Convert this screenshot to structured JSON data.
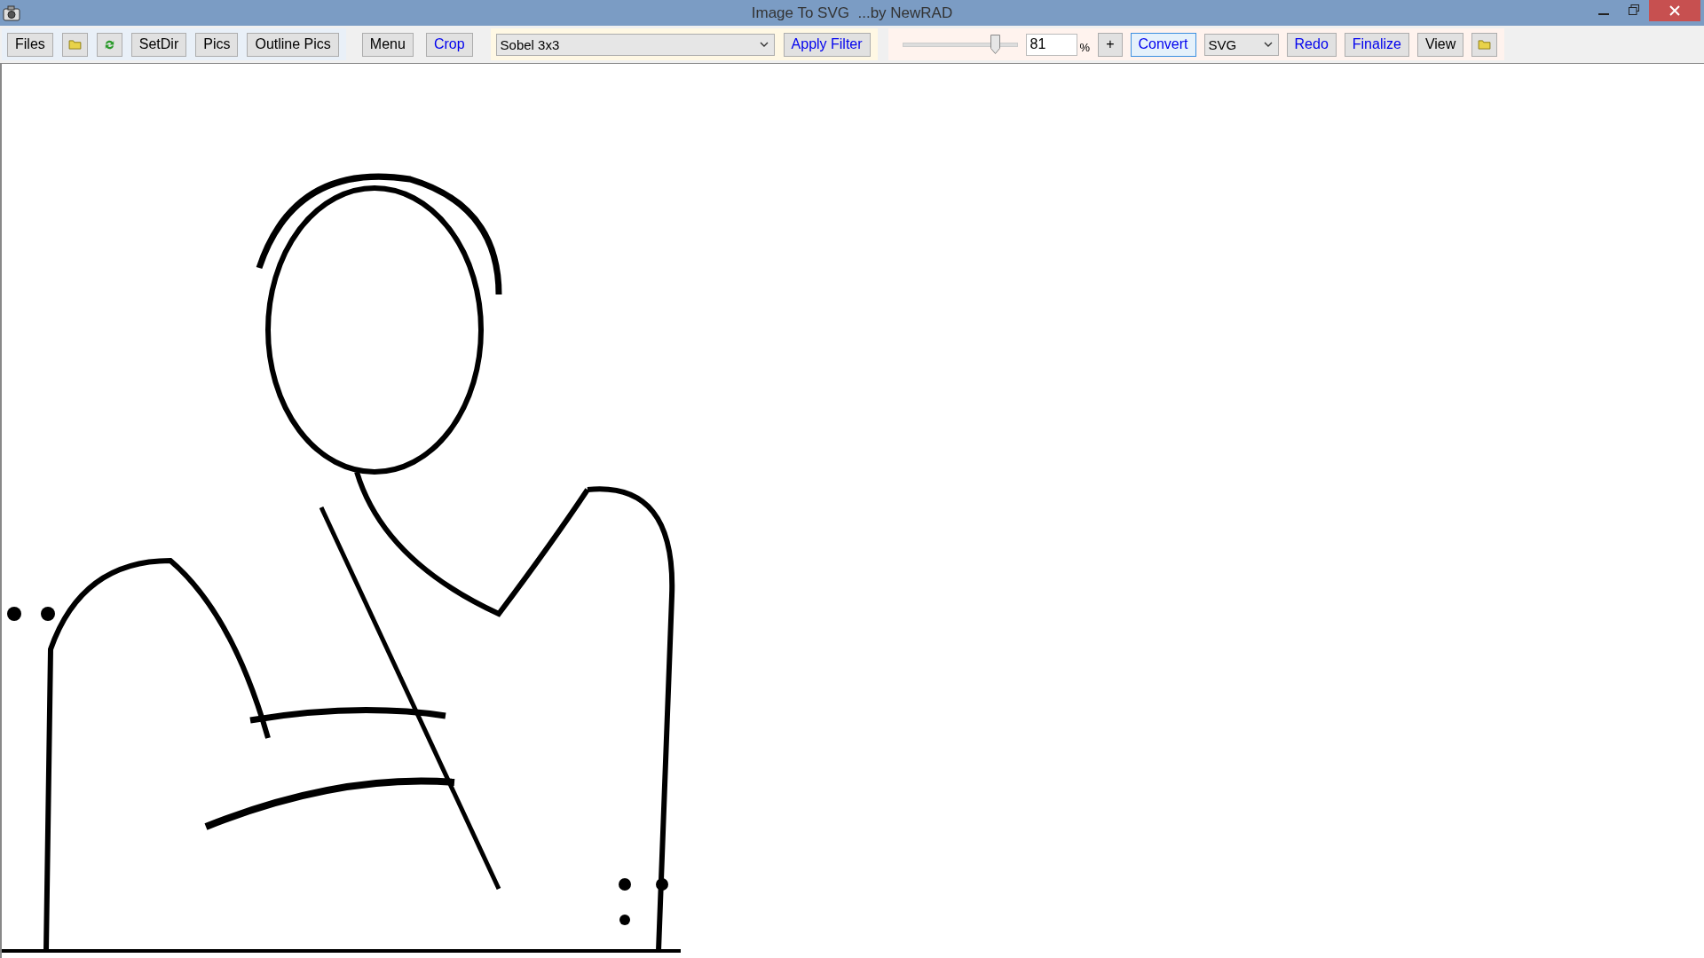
{
  "window": {
    "title": "Image To SVG  ...by NewRAD"
  },
  "toolbar": {
    "groups": [
      {
        "items": [
          {
            "kind": "button",
            "label": "Files",
            "color": "#000000"
          },
          {
            "kind": "folder"
          },
          {
            "kind": "refresh"
          },
          {
            "kind": "button",
            "label": "SetDir",
            "color": "#000000"
          },
          {
            "kind": "button",
            "label": "Pics",
            "color": "#000000"
          },
          {
            "kind": "button",
            "label": "Outline Pics",
            "color": "#000000"
          }
        ]
      },
      {
        "items": [
          {
            "kind": "button",
            "label": "Menu",
            "color": "#000000"
          },
          {
            "kind": "button",
            "label": "Crop",
            "color": "#0000ee"
          }
        ]
      },
      {
        "items": [
          {
            "kind": "select",
            "value": "Sobel 3x3"
          },
          {
            "kind": "button",
            "label": "Apply Filter",
            "color": "#0000ee"
          }
        ]
      },
      {
        "items": [
          {
            "kind": "slider",
            "level": 0.8
          },
          {
            "kind": "input",
            "value": "81"
          },
          {
            "kind": "label",
            "label": "%"
          },
          {
            "kind": "button",
            "label": "+",
            "color": "#000000"
          },
          {
            "kind": "button",
            "label": "Convert",
            "color": "#0000ee",
            "focused": true
          },
          {
            "kind": "select",
            "value": "SVG"
          },
          {
            "kind": "button",
            "label": "Redo",
            "color": "#0000ee"
          },
          {
            "kind": "button",
            "label": "Finalize",
            "color": "#0000ee"
          },
          {
            "kind": "button",
            "label": "View",
            "color": "#000000"
          },
          {
            "kind": "folder"
          }
        ]
      }
    ]
  }
}
